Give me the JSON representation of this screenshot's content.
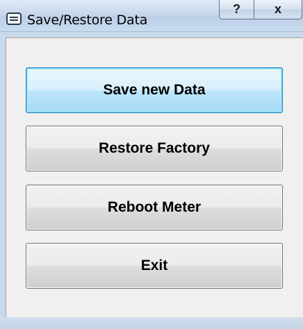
{
  "window": {
    "title": "Save/Restore Data",
    "help_label": "?",
    "close_label": "x"
  },
  "buttons": {
    "save_label": "Save new Data",
    "restore_label": "Restore Factory",
    "reboot_label": "Reboot Meter",
    "exit_label": "Exit"
  },
  "icons": {
    "app": "window-app-icon",
    "help": "help-icon",
    "close": "close-icon"
  },
  "colors": {
    "focused_button_border": "#3c7fb1",
    "titlebar": "#c8d8ec"
  }
}
